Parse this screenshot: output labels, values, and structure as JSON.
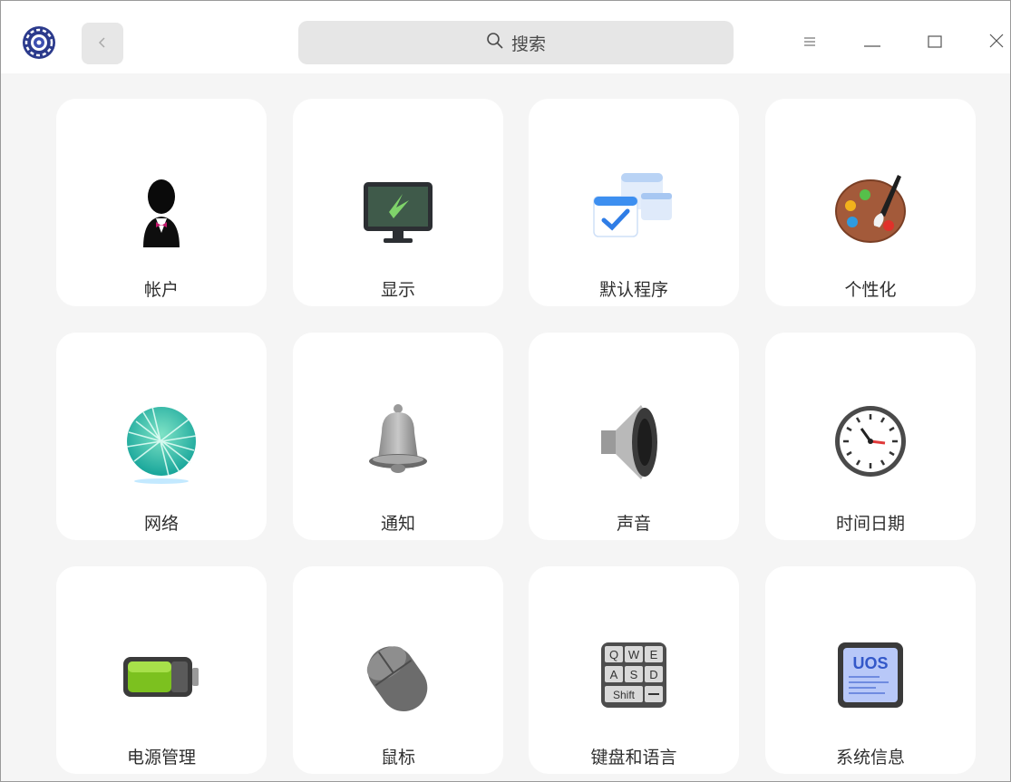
{
  "search": {
    "label": "搜索",
    "icon": "search-icon"
  },
  "titlebar": {
    "logo_icon": "control-center-logo-icon",
    "back_icon": "chevron-left-icon",
    "menu_icon": "hamburger-menu-icon",
    "minimize_icon": "minimize-icon",
    "maximize_icon": "maximize-icon",
    "close_icon": "close-icon"
  },
  "modules": [
    {
      "label": "帐户",
      "icon": "user-account-icon"
    },
    {
      "label": "显示",
      "icon": "monitor-icon"
    },
    {
      "label": "默认程序",
      "icon": "default-apps-icon"
    },
    {
      "label": "个性化",
      "icon": "palette-icon"
    },
    {
      "label": "网络",
      "icon": "network-globe-icon"
    },
    {
      "label": "通知",
      "icon": "bell-icon"
    },
    {
      "label": "声音",
      "icon": "speaker-icon"
    },
    {
      "label": "时间日期",
      "icon": "clock-icon"
    },
    {
      "label": "电源管理",
      "icon": "battery-icon"
    },
    {
      "label": "鼠标",
      "icon": "mouse-icon"
    },
    {
      "label": "键盘和语言",
      "icon": "keyboard-icon"
    },
    {
      "label": "系统信息",
      "icon": "system-info-icon"
    }
  ],
  "keyboard_keys": [
    "Q",
    "W",
    "E",
    "A",
    "S",
    "D",
    "Shift"
  ],
  "system_info_badge": "UOS"
}
